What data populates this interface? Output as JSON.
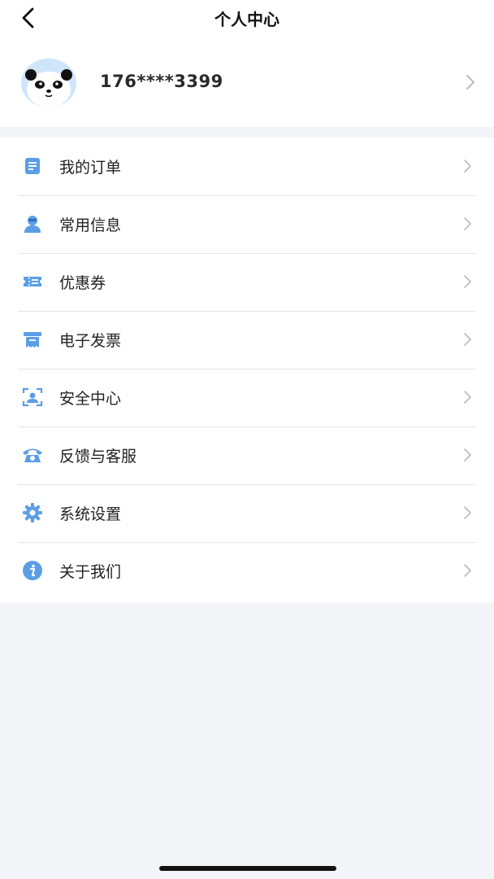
{
  "header": {
    "title": "个人中心",
    "back_icon": "back-arrow-icon"
  },
  "profile": {
    "phone": "176****3399",
    "avatar_icon": "panda-avatar"
  },
  "menu": {
    "items": [
      {
        "label": "我的订单",
        "icon": "order-icon"
      },
      {
        "label": "常用信息",
        "icon": "user-info-icon"
      },
      {
        "label": "优惠券",
        "icon": "coupon-icon"
      },
      {
        "label": "电子发票",
        "icon": "invoice-icon"
      },
      {
        "label": "安全中心",
        "icon": "security-icon"
      },
      {
        "label": "反馈与客服",
        "icon": "phone-service-icon"
      },
      {
        "label": "系统设置",
        "icon": "settings-icon"
      },
      {
        "label": "关于我们",
        "icon": "info-icon"
      }
    ]
  },
  "colors": {
    "accent": "#5b9ee6",
    "background": "#f2f4f8",
    "divider": "#e6e6e6"
  }
}
